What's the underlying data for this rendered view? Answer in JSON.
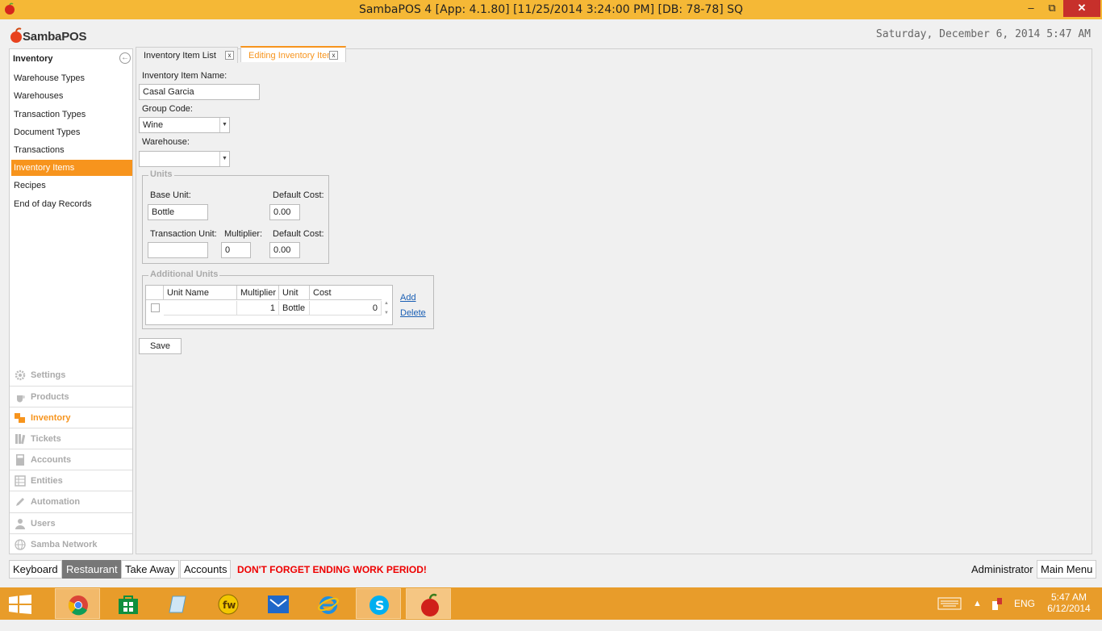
{
  "window": {
    "title": "SambaPOS 4 [App: 4.1.80] [11/25/2014 3:24:00 PM] [DB: 78-78] SQ",
    "minimize": "–",
    "maximize": "⧉",
    "close": "✕"
  },
  "header": {
    "logo_text": "SambaPOS",
    "datetime": "Saturday, December 6, 2014 5:47 AM"
  },
  "sidebar": {
    "title": "Inventory",
    "items": [
      {
        "label": "Warehouse Types"
      },
      {
        "label": "Warehouses"
      },
      {
        "label": "Transaction Types"
      },
      {
        "label": "Document Types"
      },
      {
        "label": "Transactions"
      },
      {
        "label": "Inventory Items",
        "active": true
      },
      {
        "label": "Recipes"
      },
      {
        "label": "End of day Records"
      }
    ],
    "modules": [
      {
        "label": "Settings",
        "icon": "gear-icon"
      },
      {
        "label": "Products",
        "icon": "cup-icon"
      },
      {
        "label": "Inventory",
        "icon": "inventory-icon",
        "active": true
      },
      {
        "label": "Tickets",
        "icon": "tickets-icon"
      },
      {
        "label": "Accounts",
        "icon": "calculator-icon"
      },
      {
        "label": "Entities",
        "icon": "grid-icon"
      },
      {
        "label": "Automation",
        "icon": "pencil-icon"
      },
      {
        "label": "Users",
        "icon": "user-icon"
      },
      {
        "label": "Samba Network",
        "icon": "globe-icon"
      }
    ]
  },
  "tabs": [
    {
      "label": "Inventory Item List",
      "close": "x"
    },
    {
      "label": "Editing Inventory Item",
      "close": "x",
      "active": true
    }
  ],
  "form": {
    "name_label": "Inventory Item Name:",
    "name_value": "Casal Garcia",
    "group_label": "Group Code:",
    "group_value": "Wine",
    "warehouse_label": "Warehouse:",
    "warehouse_value": "",
    "units": {
      "title": "Units",
      "base_unit_label": "Base Unit:",
      "base_unit_value": "Bottle",
      "default_cost_label": "Default Cost:",
      "default_cost_value": "0.00",
      "transaction_unit_label": "Transaction Unit:",
      "transaction_unit_value": "",
      "multiplier_label": "Multiplier:",
      "multiplier_value": "0",
      "transaction_cost_label": "Default Cost:",
      "transaction_cost_value": "0.00"
    },
    "additional_units": {
      "title": "Additional Units",
      "columns": [
        "Unit Name",
        "Multiplier",
        "Unit",
        "Cost"
      ],
      "rows": [
        {
          "unit_name": "",
          "multiplier": "1",
          "unit": "Bottle",
          "cost": "0"
        }
      ],
      "add_label": "Add",
      "delete_label": "Delete"
    },
    "save_label": "Save"
  },
  "bottombar": {
    "buttons": [
      {
        "label": "Keyboard"
      },
      {
        "label": "Restaurant",
        "active": true
      },
      {
        "label": "Take Away"
      },
      {
        "label": "Accounts"
      }
    ],
    "warning": "DON'T FORGET ENDING WORK PERIOD!",
    "user": "Administrator",
    "main_menu": "Main Menu"
  },
  "taskbar": {
    "lang": "ENG",
    "time": "5:47 AM",
    "date": "6/12/2014"
  },
  "colors": {
    "accent": "#f7941d",
    "titlebar": "#f5b836",
    "taskbar": "#e89c2a",
    "warning": "#ee0000"
  }
}
